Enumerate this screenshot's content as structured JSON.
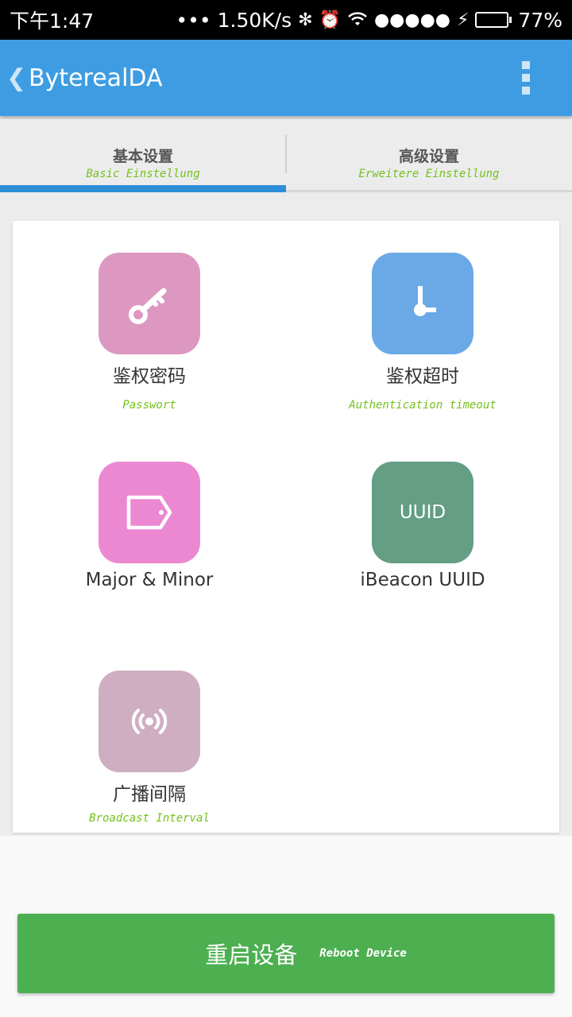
{
  "status_bar": {
    "time": "下午1:47",
    "dots": "•••",
    "speed": "1.50K/s",
    "bluetooth_icon": "✻",
    "alarm_icon": "⏰",
    "wifi_icon": "wifi-icon",
    "signal": "●●●●●",
    "charging_icon": "⚡",
    "battery_percent": "77%",
    "battery_level": 0.77
  },
  "app_bar": {
    "back_glyph": "❮",
    "title": "ByterealDA"
  },
  "tabs": [
    {
      "label": "基本设置",
      "sub": "Basic Einstellung",
      "active": true
    },
    {
      "label": "高级设置",
      "sub": "Erweitere Einstellung",
      "active": false
    }
  ],
  "tiles": [
    {
      "label": "鉴权密码",
      "sub": "Passwort",
      "icon": "key-icon",
      "color": "#dc98c0"
    },
    {
      "label": "鉴权超时",
      "sub": "Authentication timeout",
      "icon": "clock-icon",
      "color": "#6aa9e6"
    },
    {
      "label": "Major & Minor",
      "sub": "",
      "icon": "tag-icon",
      "color": "#ec88d2"
    },
    {
      "label": "iBeacon UUID",
      "sub": "",
      "icon": "uuid-icon",
      "icon_text": "UUID",
      "color": "#639e85"
    },
    {
      "label": "广播间隔",
      "sub": "Broadcast Interval",
      "icon": "broadcast-icon",
      "color": "#cfaec2"
    }
  ],
  "reboot": {
    "label": "重启设备",
    "sub": "Reboot Device",
    "color": "#4caf50"
  }
}
